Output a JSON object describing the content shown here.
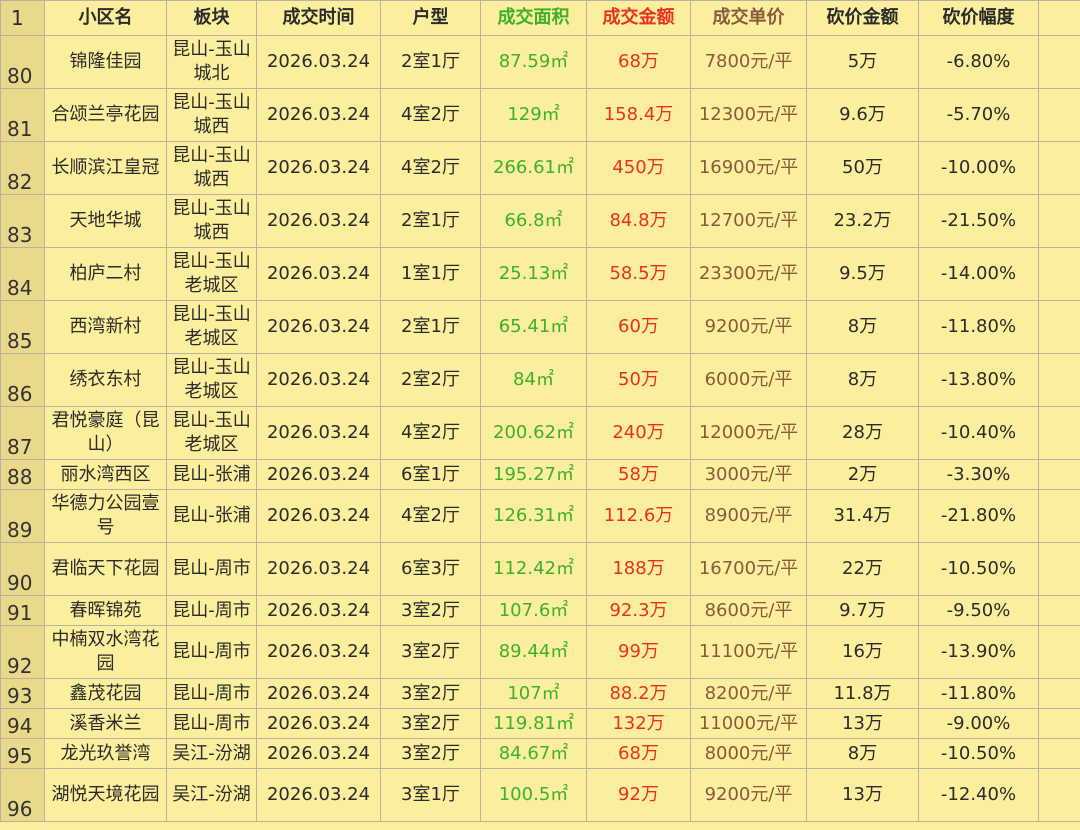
{
  "header": {
    "row_label": "1",
    "columns": [
      "小区名",
      "板块",
      "成交时间",
      "户型",
      "成交面积",
      "成交金额",
      "成交单价",
      "砍价金额",
      "砍价幅度"
    ]
  },
  "colors": {
    "background": "#FBEF9D",
    "index_column": "#E8DA8A",
    "area": "#3db02f",
    "amount": "#e8321f",
    "unit_price": "#8a5a3c"
  },
  "rows": [
    {
      "idx": "80",
      "name": "锦隆佳园",
      "area_block": "昆山-玉山城北",
      "date": "2026.03.24",
      "layout": "2室1厅",
      "size": "87.59㎡",
      "amount": "68万",
      "unit_price": "7800元/平",
      "discount": "5万",
      "discount_pct": "-6.80%"
    },
    {
      "idx": "81",
      "name": "合颂兰亭花园",
      "area_block": "昆山-玉山城西",
      "date": "2026.03.24",
      "layout": "4室2厅",
      "size": "129㎡",
      "amount": "158.4万",
      "unit_price": "12300元/平",
      "discount": "9.6万",
      "discount_pct": "-5.70%"
    },
    {
      "idx": "82",
      "name": "长顺滨江皇冠",
      "area_block": "昆山-玉山城西",
      "date": "2026.03.24",
      "layout": "4室2厅",
      "size": "266.61㎡",
      "amount": "450万",
      "unit_price": "16900元/平",
      "discount": "50万",
      "discount_pct": "-10.00%"
    },
    {
      "idx": "83",
      "name": "天地华城",
      "area_block": "昆山-玉山城西",
      "date": "2026.03.24",
      "layout": "2室1厅",
      "size": "66.8㎡",
      "amount": "84.8万",
      "unit_price": "12700元/平",
      "discount": "23.2万",
      "discount_pct": "-21.50%"
    },
    {
      "idx": "84",
      "name": "柏庐二村",
      "area_block": "昆山-玉山老城区",
      "date": "2026.03.24",
      "layout": "1室1厅",
      "size": "25.13㎡",
      "amount": "58.5万",
      "unit_price": "23300元/平",
      "discount": "9.5万",
      "discount_pct": "-14.00%"
    },
    {
      "idx": "85",
      "name": "西湾新村",
      "area_block": "昆山-玉山老城区",
      "date": "2026.03.24",
      "layout": "2室1厅",
      "size": "65.41㎡",
      "amount": "60万",
      "unit_price": "9200元/平",
      "discount": "8万",
      "discount_pct": "-11.80%"
    },
    {
      "idx": "86",
      "name": "绣衣东村",
      "area_block": "昆山-玉山老城区",
      "date": "2026.03.24",
      "layout": "2室2厅",
      "size": "84㎡",
      "amount": "50万",
      "unit_price": "6000元/平",
      "discount": "8万",
      "discount_pct": "-13.80%"
    },
    {
      "idx": "87",
      "name": "君悦豪庭（昆山）",
      "area_block": "昆山-玉山老城区",
      "date": "2026.03.24",
      "layout": "4室2厅",
      "size": "200.62㎡",
      "amount": "240万",
      "unit_price": "12000元/平",
      "discount": "28万",
      "discount_pct": "-10.40%"
    },
    {
      "idx": "88",
      "name": "丽水湾西区",
      "area_block": "昆山-张浦",
      "date": "2026.03.24",
      "layout": "6室1厅",
      "size": "195.27㎡",
      "amount": "58万",
      "unit_price": "3000元/平",
      "discount": "2万",
      "discount_pct": "-3.30%"
    },
    {
      "idx": "89",
      "name": "华德力公园壹号",
      "area_block": "昆山-张浦",
      "date": "2026.03.24",
      "layout": "4室2厅",
      "size": "126.31㎡",
      "amount": "112.6万",
      "unit_price": "8900元/平",
      "discount": "31.4万",
      "discount_pct": "-21.80%"
    },
    {
      "idx": "90",
      "name": "君临天下花园",
      "area_block": "昆山-周市",
      "date": "2026.03.24",
      "layout": "6室3厅",
      "size": "112.42㎡",
      "amount": "188万",
      "unit_price": "16700元/平",
      "discount": "22万",
      "discount_pct": "-10.50%"
    },
    {
      "idx": "91",
      "name": "春晖锦苑",
      "area_block": "昆山-周市",
      "date": "2026.03.24",
      "layout": "3室2厅",
      "size": "107.6㎡",
      "amount": "92.3万",
      "unit_price": "8600元/平",
      "discount": "9.7万",
      "discount_pct": "-9.50%"
    },
    {
      "idx": "92",
      "name": "中楠双水湾花园",
      "area_block": "昆山-周市",
      "date": "2026.03.24",
      "layout": "3室2厅",
      "size": "89.44㎡",
      "amount": "99万",
      "unit_price": "11100元/平",
      "discount": "16万",
      "discount_pct": "-13.90%"
    },
    {
      "idx": "93",
      "name": "鑫茂花园",
      "area_block": "昆山-周市",
      "date": "2026.03.24",
      "layout": "3室2厅",
      "size": "107㎡",
      "amount": "88.2万",
      "unit_price": "8200元/平",
      "discount": "11.8万",
      "discount_pct": "-11.80%"
    },
    {
      "idx": "94",
      "name": "溪香米兰",
      "area_block": "昆山-周市",
      "date": "2026.03.24",
      "layout": "3室2厅",
      "size": "119.81㎡",
      "amount": "132万",
      "unit_price": "11000元/平",
      "discount": "13万",
      "discount_pct": "-9.00%"
    },
    {
      "idx": "95",
      "name": "龙光玖誉湾",
      "area_block": "吴江-汾湖",
      "date": "2026.03.24",
      "layout": "3室2厅",
      "size": "84.67㎡",
      "amount": "68万",
      "unit_price": "8000元/平",
      "discount": "8万",
      "discount_pct": "-10.50%"
    },
    {
      "idx": "96",
      "name": "湖悦天境花园",
      "area_block": "吴江-汾湖",
      "date": "2026.03.24",
      "layout": "3室1厅",
      "size": "100.5㎡",
      "amount": "92万",
      "unit_price": "9200元/平",
      "discount": "13万",
      "discount_pct": "-12.40%"
    }
  ]
}
